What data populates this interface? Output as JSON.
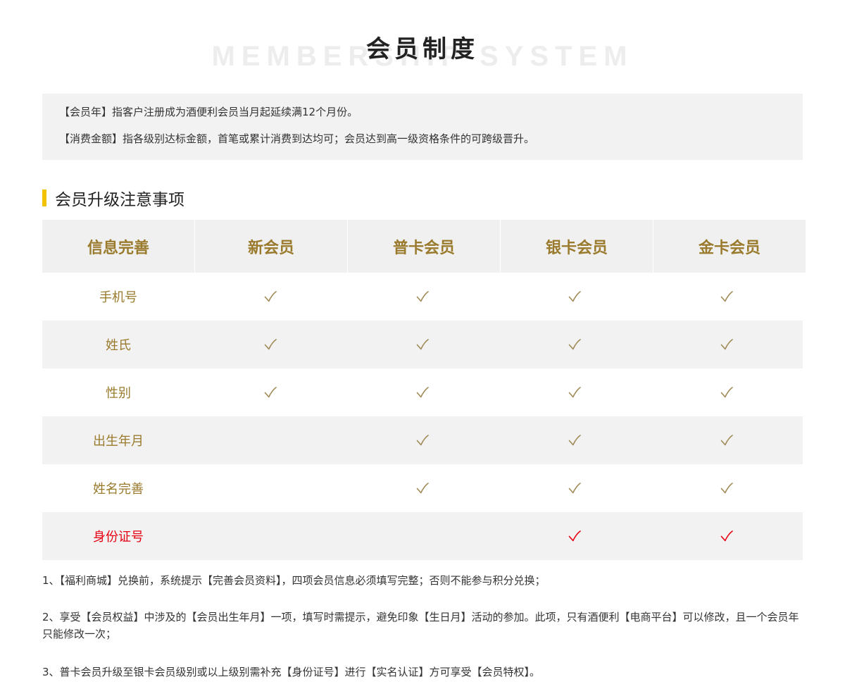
{
  "header": {
    "title": "会员制度",
    "subtitle_bg": "MEMBERSHIP SYSTEM"
  },
  "definitions": [
    "【会员年】指客户注册成为酒便利会员当月起延续满12个月份。",
    "【消费金额】指各级别达标金额，首笔或累计消费到达均可；会员达到高一级资格条件的可跨级晋升。"
  ],
  "section": {
    "title": "会员升级注意事项",
    "accent_color": "#f2c100"
  },
  "table": {
    "headers": [
      "信息完善",
      "新会员",
      "普卡会员",
      "银卡会员",
      "金卡会员"
    ],
    "rows": [
      {
        "label": "手机号",
        "cells": [
          true,
          true,
          true,
          true
        ],
        "highlight": false
      },
      {
        "label": "姓氏",
        "cells": [
          true,
          true,
          true,
          true
        ],
        "highlight": false
      },
      {
        "label": "性别",
        "cells": [
          true,
          true,
          true,
          true
        ],
        "highlight": false
      },
      {
        "label": "出生年月",
        "cells": [
          false,
          true,
          true,
          true
        ],
        "highlight": false
      },
      {
        "label": "姓名完善",
        "cells": [
          false,
          true,
          true,
          true
        ],
        "highlight": false
      },
      {
        "label": "身份证号",
        "cells": [
          false,
          false,
          true,
          true
        ],
        "highlight": true
      }
    ],
    "check_glyph": "✓",
    "colors": {
      "gold": "#9a7b2d",
      "check": "#a08a55",
      "red": "#e60012",
      "header_bg": "#f0f0f0",
      "stripe_bg": "#f2f2f2"
    }
  },
  "notes": [
    "1、【福利商城】兑换前，系统提示【完善会员资料】，四项会员信息必须填写完整；否则不能参与积分兑换；",
    "2、享受【会员权益】中涉及的【会员出生年月】一项，填写时需提示，避免印象【生日月】活动的参加。此项，只有酒便利【电商平台】可以修改，且一个会员年只能修改一次；",
    "3、普卡会员升级至银卡会员级别或以上级别需补充【身份证号】进行【实名认证】方可享受【会员特权】。"
  ]
}
